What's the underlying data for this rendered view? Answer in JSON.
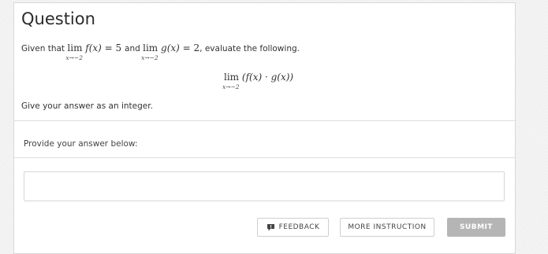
{
  "question": {
    "title": "Question",
    "prompt_before": "Given that",
    "prompt_and": "and",
    "prompt_after": ", evaluate the following.",
    "lim_word": "lim",
    "limit1": {
      "subscript": "x→−2",
      "func": "f(x)",
      "equals": " = ",
      "value": "5"
    },
    "limit2": {
      "subscript": "x→−2",
      "func": "g(x)",
      "equals": " = ",
      "value": "2"
    },
    "expression": {
      "subscript": "x→−2",
      "body": "(f(x) · g(x))"
    },
    "instruction": "Give your answer as an integer."
  },
  "answer": {
    "label": "Provide your answer below:",
    "value": "",
    "placeholder": ""
  },
  "buttons": {
    "feedback": "FEEDBACK",
    "more_instruction": "MORE INSTRUCTION",
    "submit": "SUBMIT"
  },
  "colors": {
    "submit_bg": "#b5b5b5",
    "card_bg": "#ffffff",
    "border": "#d8d8d8"
  }
}
